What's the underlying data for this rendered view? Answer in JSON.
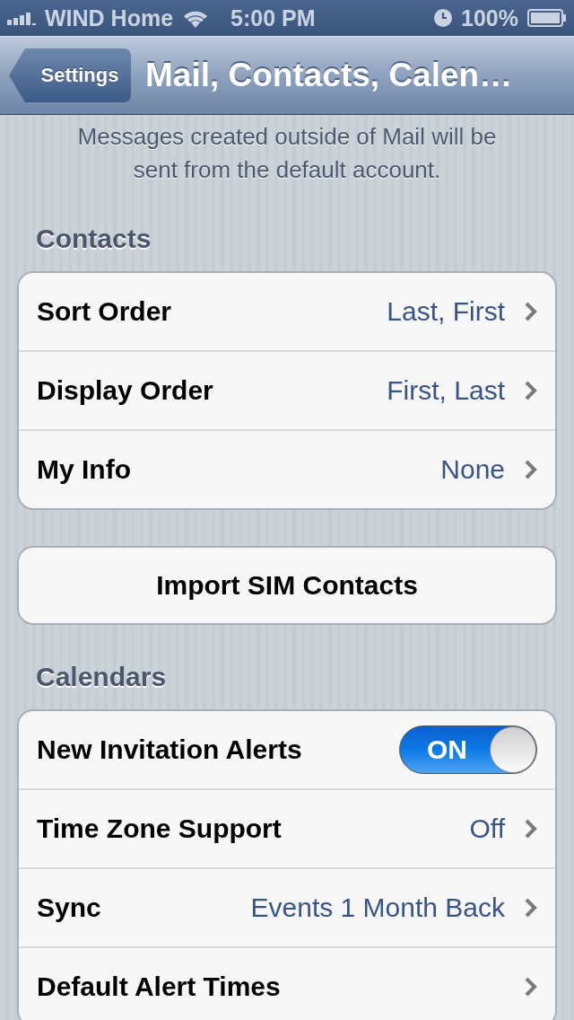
{
  "status_bar": {
    "carrier": "WIND Home",
    "time": "5:00 PM",
    "battery": "100%"
  },
  "nav_bar": {
    "back": "Settings",
    "title": "Mail, Contacts, Calen…"
  },
  "top_footer": "Messages created outside of Mail will be sent from the default account.",
  "contacts": {
    "header": "Contacts",
    "rows": [
      {
        "kind": "detail",
        "label": "Sort Order",
        "value": "Last, First"
      },
      {
        "kind": "detail",
        "label": "Display Order",
        "value": "First, Last"
      },
      {
        "kind": "detail",
        "label": "My Info",
        "value": "None"
      }
    ]
  },
  "import_button": "Import SIM Contacts",
  "calendars": {
    "header": "Calendars",
    "rows": [
      {
        "kind": "toggle",
        "label": "New Invitation Alerts",
        "on": true,
        "on_text": "ON"
      },
      {
        "kind": "detail",
        "label": "Time Zone Support",
        "value": "Off"
      },
      {
        "kind": "detail",
        "label": "Sync",
        "value": "Events 1 Month Back"
      },
      {
        "kind": "detail",
        "label": "Default Alert Times"
      }
    ]
  }
}
